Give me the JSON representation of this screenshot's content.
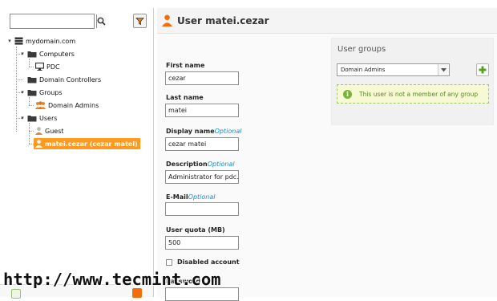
{
  "search": {
    "placeholder": "",
    "value": ""
  },
  "tree": {
    "root": {
      "label": "mydomain.com",
      "icon": "server-icon"
    },
    "computers": {
      "label": "Computers",
      "icon": "folder-icon"
    },
    "pdc": {
      "label": "PDC",
      "icon": "monitor-icon"
    },
    "domain_controllers": {
      "label": "Domain Controllers",
      "icon": "folder-icon"
    },
    "groups": {
      "label": "Groups",
      "icon": "folder-icon"
    },
    "domain_admins": {
      "label": "Domain Admins",
      "icon": "group-icon"
    },
    "users": {
      "label": "Users",
      "icon": "folder-icon"
    },
    "guest": {
      "label": "Guest",
      "icon": "user-icon"
    },
    "selected_user": {
      "label": "matei.cezar (cezar matei)",
      "icon": "user-icon"
    },
    "expand_glyph": "▸",
    "collapse_glyph": "▾"
  },
  "header": {
    "title": "User matei.cezar"
  },
  "form": {
    "first_name": {
      "label": "First name",
      "value": "cezar"
    },
    "last_name": {
      "label": "Last name",
      "value": "matei"
    },
    "display_name": {
      "label": "Display name",
      "optional": "Optional",
      "value": "cezar matei"
    },
    "description": {
      "label": "Description",
      "optional": "Optional",
      "value": "Administrator for pdc."
    },
    "email": {
      "label": "E-Mail",
      "optional": "Optional",
      "value": ""
    },
    "quota": {
      "label": "User quota (MB)",
      "value": "500"
    },
    "disabled": {
      "label": "Disabled account",
      "checked": false
    },
    "password": {
      "label": "Password"
    }
  },
  "groups_panel": {
    "title": "User groups",
    "selected_group": "Domain Admins",
    "notice": "This user is not a member of any group",
    "notice_icon": "i"
  },
  "watermark": "http://www.tecmint.com",
  "colors": {
    "accent_orange": "#ff9a1e",
    "notice_green": "#7bb23f",
    "optional_blue": "#1a8ec9"
  }
}
